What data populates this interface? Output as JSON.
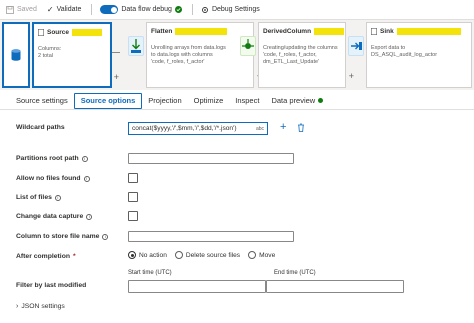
{
  "toolbar": {
    "saved_label": "Saved",
    "validate_label": "Validate",
    "data_flow_debug_label": "Data flow debug",
    "debug_settings_label": "Debug Settings"
  },
  "nodes": [
    {
      "title": "Source",
      "body": "Columns:\n2 total"
    },
    {
      "title": "Flatten",
      "body": "Unrolling arrays from data.logs\nto data.logs with columns\n'code, f_roles, f_actor'"
    },
    {
      "title": "DerivedColumn",
      "body": "Creating/updating the columns\n'code, f_roles, f_actor,\ndm_ETL_Last_Update'"
    },
    {
      "title": "Sink",
      "body": "Export data to\nDS_ASQL_audit_log_actor"
    }
  ],
  "tabs": [
    {
      "label": "Source settings"
    },
    {
      "label": "Source options"
    },
    {
      "label": "Projection"
    },
    {
      "label": "Optimize"
    },
    {
      "label": "Inspect"
    },
    {
      "label": "Data preview"
    }
  ],
  "form": {
    "wildcard_paths_label": "Wildcard paths",
    "wildcard_value": "concat($yyyy,'/',$mm,'/',$dd,'/*.json')",
    "partitions_root_path_label": "Partitions root path",
    "allow_no_files_found_label": "Allow no files found",
    "list_of_files_label": "List of files",
    "change_data_capture_label": "Change data capture",
    "column_to_store_file_name_label": "Column to store file name",
    "after_completion_label": "After completion",
    "after_completion_options": [
      "No action",
      "Delete source files",
      "Move"
    ],
    "after_completion_selected": "No action",
    "filter_by_last_modified_label": "Filter by last modified",
    "start_time_label": "Start time (UTC)",
    "end_time_label": "End time (UTC)",
    "json_settings_label": "JSON settings"
  },
  "colors": {
    "accent": "#0f6cbd",
    "redaction": "#f4e30b",
    "status_green": "#107c10"
  }
}
